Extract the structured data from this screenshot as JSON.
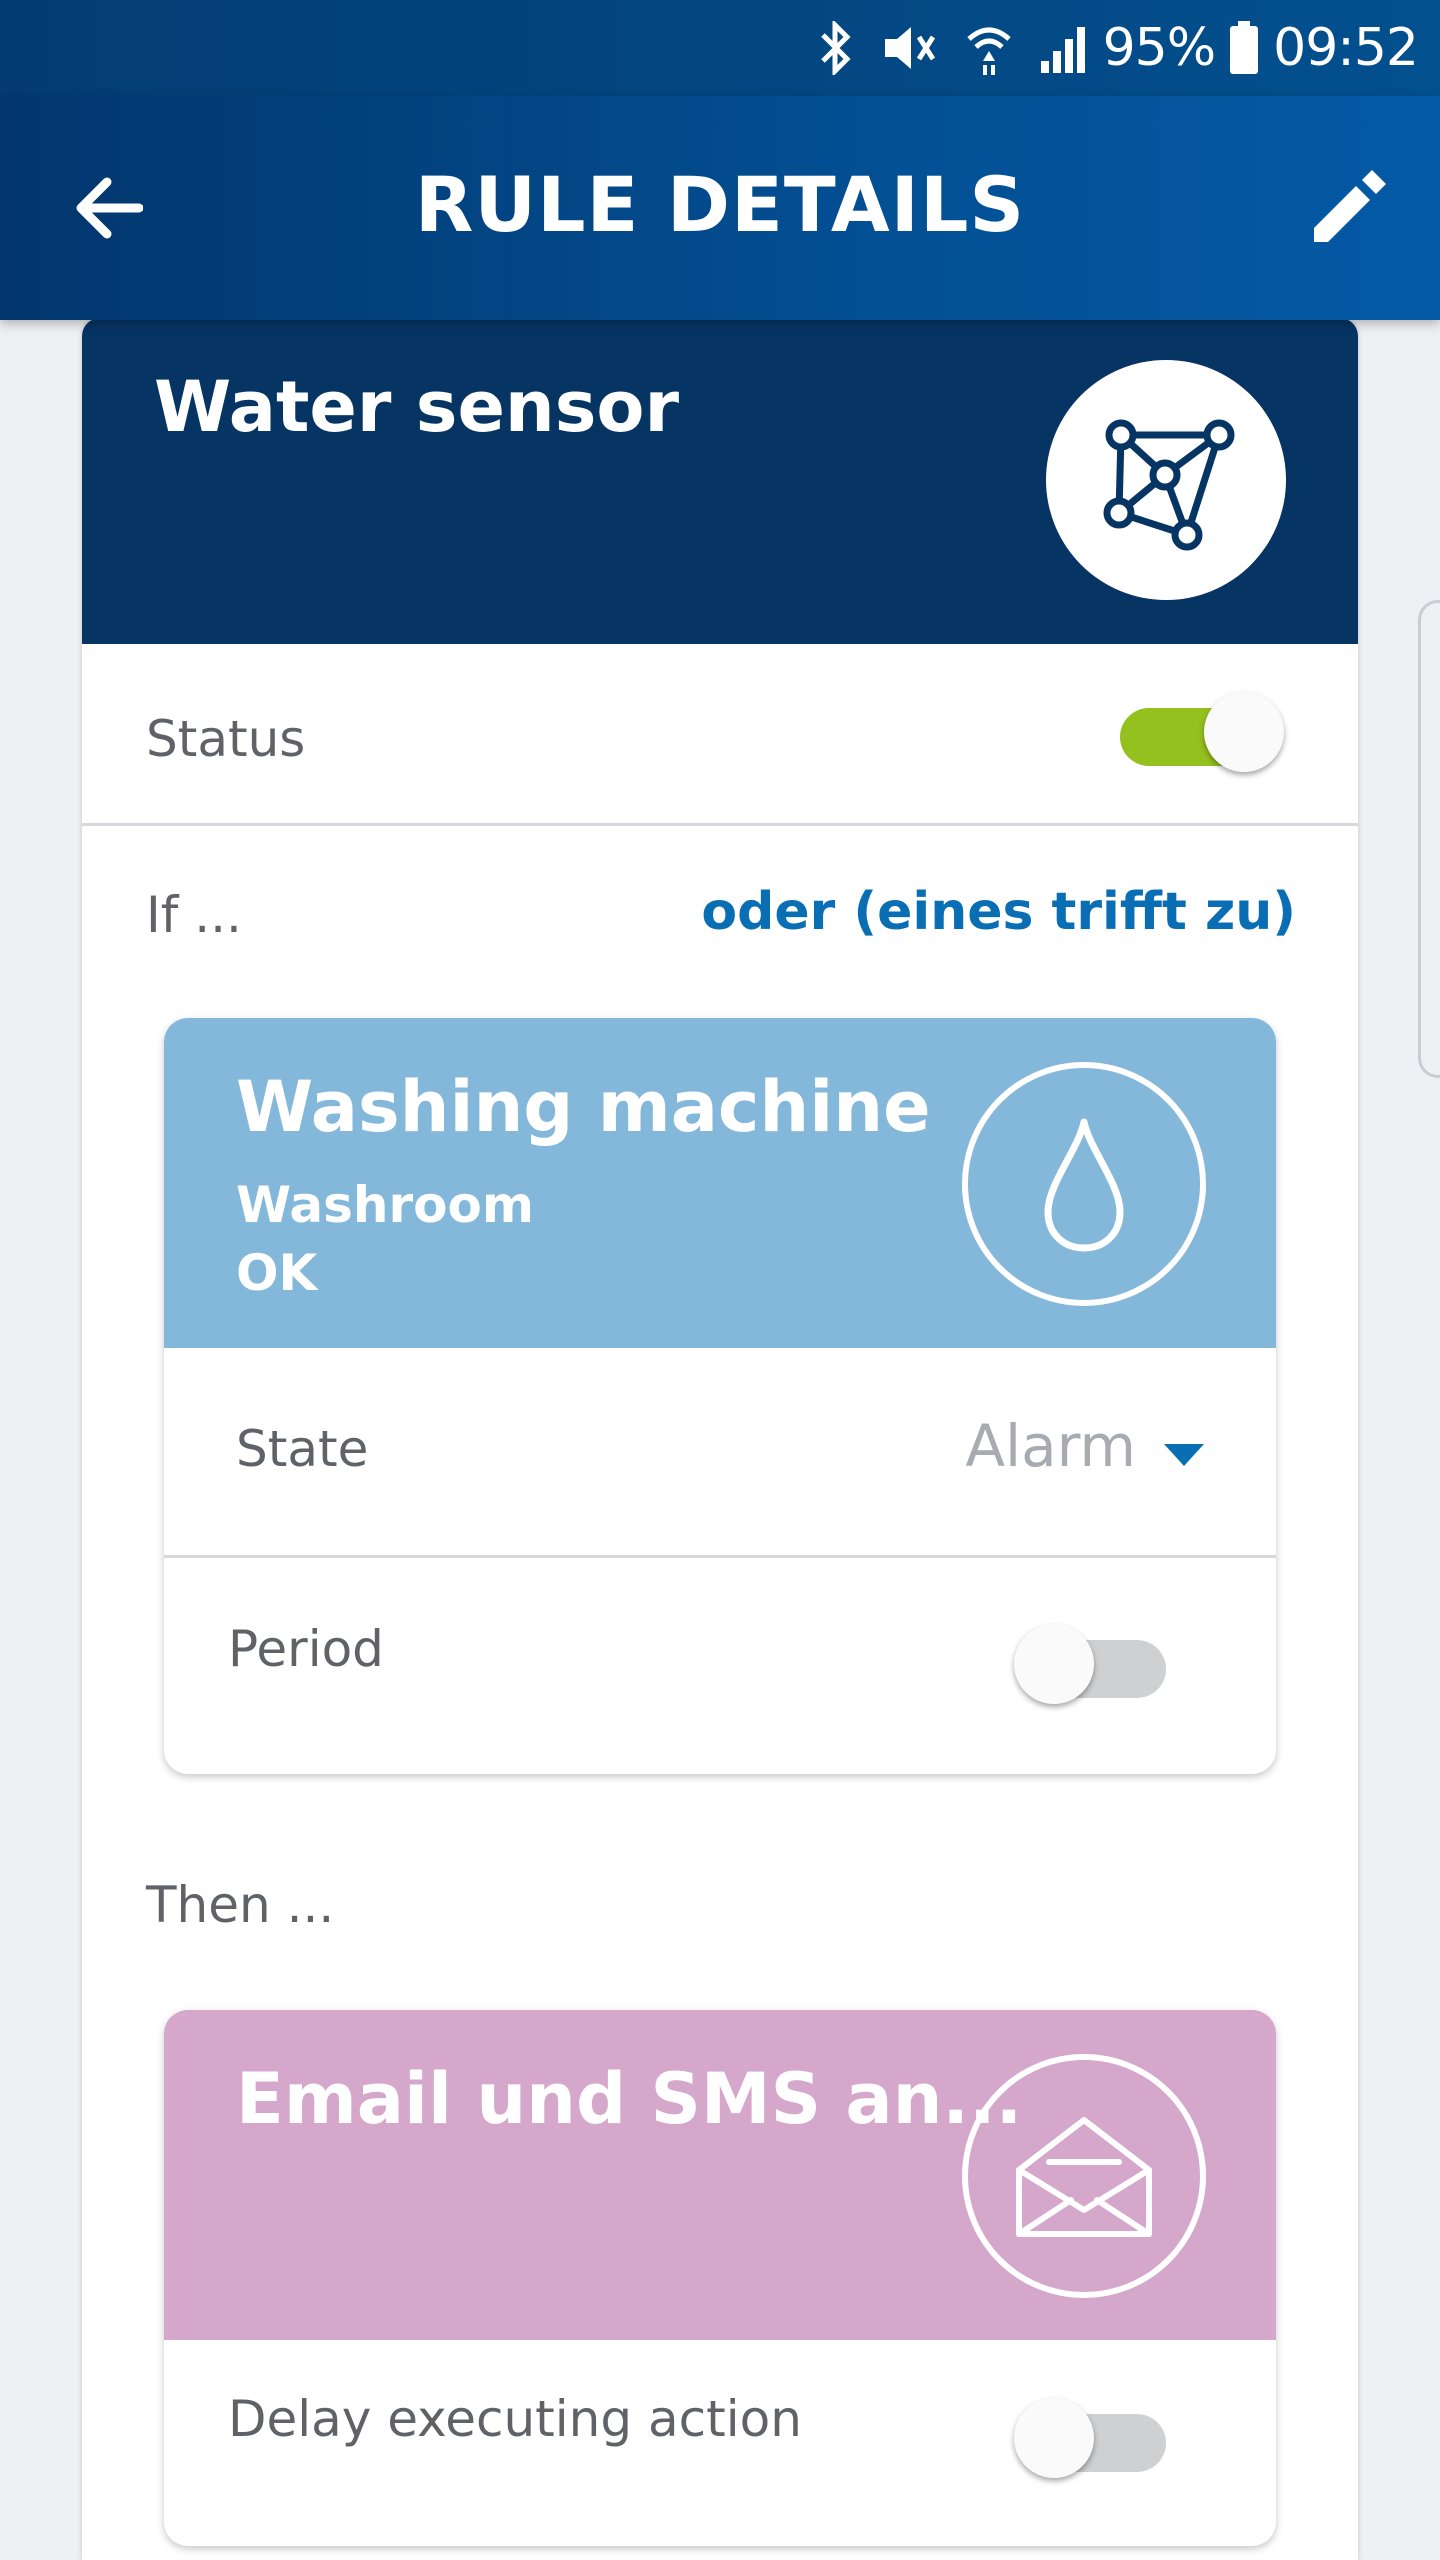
{
  "status_bar": {
    "battery": "95%",
    "time": "09:52",
    "icons": [
      "bluetooth-icon",
      "mute-icon",
      "wifi-icon",
      "signal-icon",
      "battery-icon"
    ]
  },
  "app_bar": {
    "title": "RULE DETAILS",
    "back_icon": "arrow-left-icon",
    "edit_icon": "pencil-icon"
  },
  "rule": {
    "name": "Water sensor",
    "icon": "network-graph-icon",
    "status_label": "Status",
    "status_on": true
  },
  "condition": {
    "if_label": "If ...",
    "logic_link": "oder (eines trifft zu)",
    "trigger": {
      "title": "Washing machine",
      "room": "Washroom",
      "state_text": "OK",
      "icon": "water-drop-icon",
      "state_label": "State",
      "state_value": "Alarm",
      "period_label": "Period",
      "period_on": false
    }
  },
  "action": {
    "then_label": "Then ...",
    "title": "Email und SMS an...",
    "icon": "open-envelope-icon",
    "delay_label": "Delay executing action",
    "delay_on": false
  },
  "colors": {
    "header_blue": "#063463",
    "appbar_blue": "#034f93",
    "trigger_blue": "#84b8da",
    "action_pink": "#d5a7cb",
    "toggle_green": "#95c11f",
    "link_blue": "#0a6eb4"
  }
}
